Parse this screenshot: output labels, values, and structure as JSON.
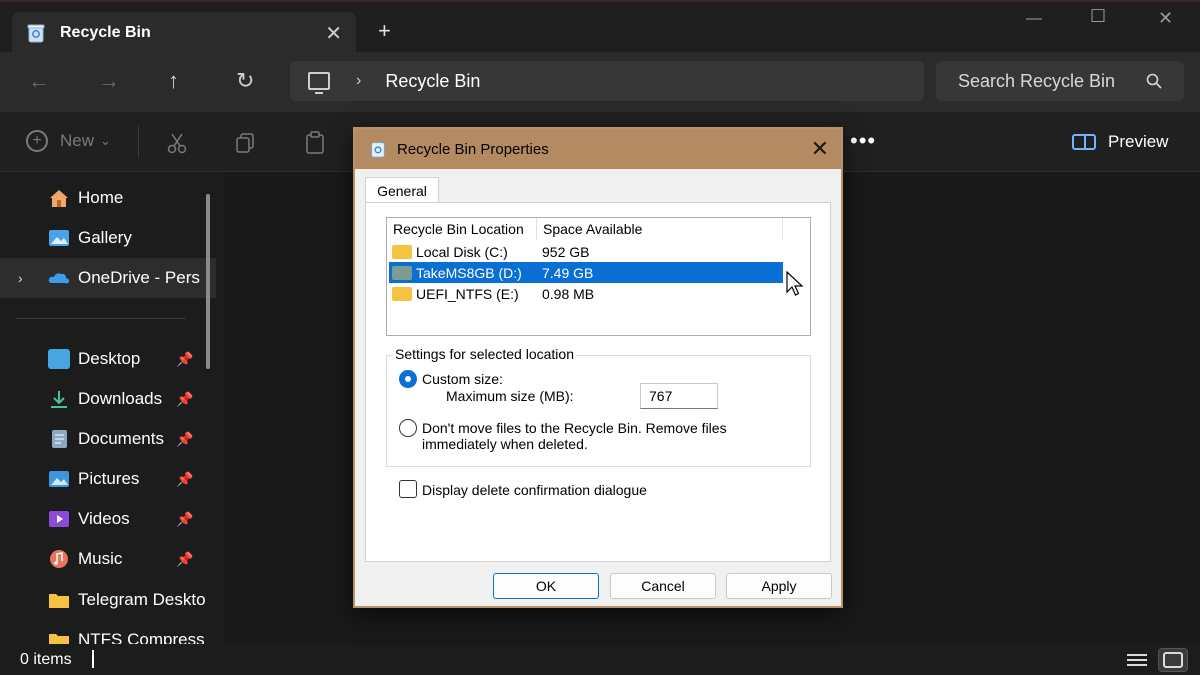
{
  "colors": {
    "accent": "#0a6fd2",
    "dialog_frame": "#b48a63",
    "folder": "#f5c242"
  },
  "window": {
    "tab_title": "Recycle Bin",
    "tab_close": "✕",
    "new_tab": "+",
    "minimize": "—",
    "maximize": "☐",
    "close": "✕"
  },
  "nav": {
    "back": "←",
    "forward": "→",
    "up": "↑",
    "refresh": "↻",
    "crumb_separator": "›",
    "breadcrumb": "Recycle Bin",
    "search_placeholder": "Search Recycle Bin"
  },
  "toolbar": {
    "new_label": "New",
    "new_caret": "⌄",
    "more": "•••",
    "preview_label": "Preview"
  },
  "sidebar": {
    "items": [
      {
        "label": "Home",
        "icon": "home-icon",
        "pinned": false
      },
      {
        "label": "Gallery",
        "icon": "gallery-icon",
        "pinned": false
      },
      {
        "label": "OneDrive - Pers",
        "icon": "onedrive-icon",
        "pinned": false,
        "selected": true
      },
      {
        "label": "Desktop",
        "icon": "desktop-icon",
        "pinned": true
      },
      {
        "label": "Downloads",
        "icon": "downloads-icon",
        "pinned": true
      },
      {
        "label": "Documents",
        "icon": "documents-icon",
        "pinned": true
      },
      {
        "label": "Pictures",
        "icon": "pictures-icon",
        "pinned": true
      },
      {
        "label": "Videos",
        "icon": "videos-icon",
        "pinned": true
      },
      {
        "label": "Music",
        "icon": "music-icon",
        "pinned": true
      },
      {
        "label": "Telegram Deskto",
        "icon": "folder-icon",
        "pinned": false
      },
      {
        "label": "NTFS Compress",
        "icon": "folder-icon",
        "pinned": false
      }
    ],
    "pin_glyph": "📌",
    "expander_glyph": "›"
  },
  "status": {
    "items_count": "0 items"
  },
  "dialog": {
    "title": "Recycle Bin Properties",
    "close": "✕",
    "tab": "General",
    "columns": [
      "Recycle Bin Location",
      "Space Available"
    ],
    "rows": [
      {
        "location": "Local Disk (C:)",
        "space": "952 GB",
        "selected": false
      },
      {
        "location": "TakeMS8GB (D:)",
        "space": "7.49 GB",
        "selected": true
      },
      {
        "location": "UEFI_NTFS (E:)",
        "space": "0.98 MB",
        "selected": false
      }
    ],
    "settings_group": "Settings for selected location",
    "custom_size_label": "Custom size:",
    "max_size_label": "Maximum size (MB):",
    "max_size_value": "767",
    "dont_move_line1": "Don't move files to the Recycle Bin. Remove files",
    "dont_move_line2": "immediately when deleted.",
    "display_confirm": "Display delete confirmation dialogue",
    "ok": "OK",
    "cancel": "Cancel",
    "apply": "Apply"
  }
}
